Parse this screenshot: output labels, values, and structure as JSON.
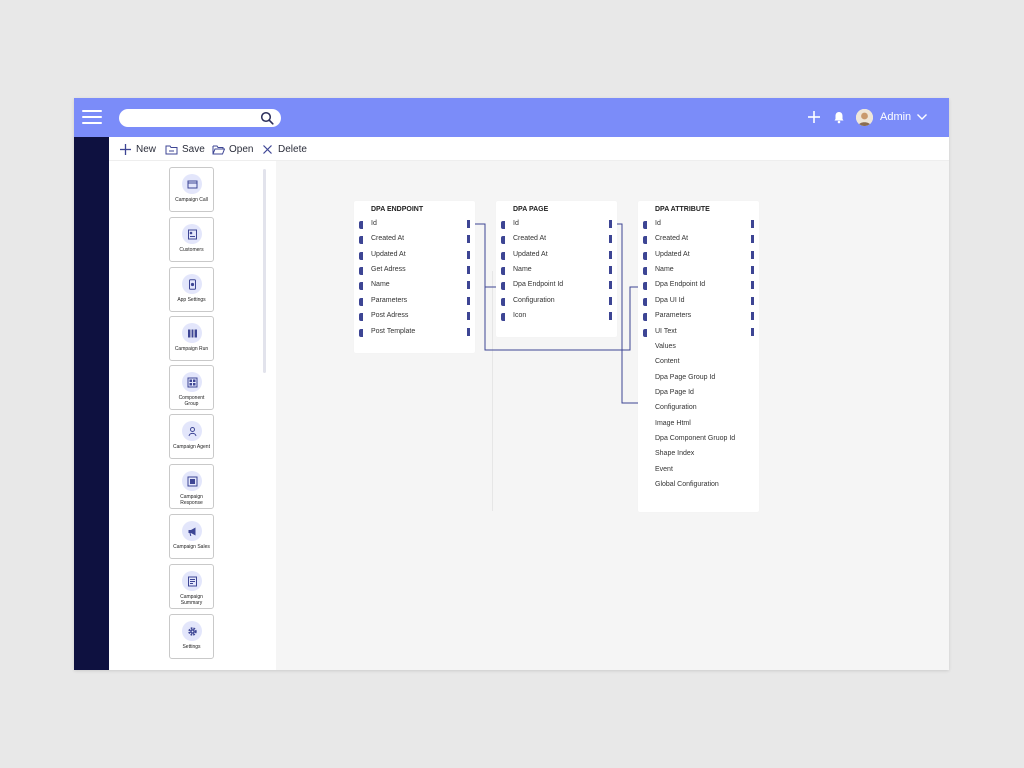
{
  "search": {
    "placeholder": ""
  },
  "header": {
    "username": "Admin"
  },
  "toolbar": {
    "new_label": "New",
    "save_label": "Save",
    "open_label": "Open",
    "delete_label": "Delete"
  },
  "palette": [
    {
      "label": "Campaign Call",
      "icon": "phone-card-icon"
    },
    {
      "label": "Customers",
      "icon": "customers-icon"
    },
    {
      "label": "App Settings",
      "icon": "app-settings-icon"
    },
    {
      "label": "Campaign Run",
      "icon": "campaign-run-icon"
    },
    {
      "label": "Component Group",
      "icon": "component-group-icon"
    },
    {
      "label": "Campaign Agent",
      "icon": "agent-icon"
    },
    {
      "label": "Campaign Response",
      "icon": "response-icon"
    },
    {
      "label": "Campaign Sales",
      "icon": "megaphone-icon"
    },
    {
      "label": "Campaign Summary",
      "icon": "summary-icon"
    },
    {
      "label": "Settings",
      "icon": "gear-icon"
    }
  ],
  "entities": {
    "dpa_endpoint": {
      "title": "DPA ENDPOINT",
      "fields": [
        "Id",
        "Created At",
        "Updated At",
        "Get Adress",
        "Name",
        "Parameters",
        "Post Adress",
        "Post Template"
      ]
    },
    "dpa_page": {
      "title": "DPA PAGE",
      "fields": [
        "Id",
        "Created At",
        "Updated At",
        "Name",
        "Dpa Endpoint Id",
        "Configuration",
        "Icon"
      ]
    },
    "dpa_attribute": {
      "title": "DPA ATTRIBUTE",
      "handled_fields": [
        "Id",
        "Created At",
        "Updated At",
        "Name",
        "Dpa Endpoint Id",
        "Dpa UI Id",
        "Parameters",
        "UI Text"
      ],
      "plain_fields": [
        "Values",
        "Content",
        "Dpa Page Group Id",
        "Dpa Page Id",
        "Configuration",
        "Image Html",
        "Dpa Component Gruop Id",
        "Shape Index",
        "Event",
        "Global Configuration"
      ]
    }
  },
  "colors": {
    "topbar": "#7b8cf9",
    "rail": "#0e1140",
    "handle": "#3d4594",
    "connector": "#3d4594"
  }
}
